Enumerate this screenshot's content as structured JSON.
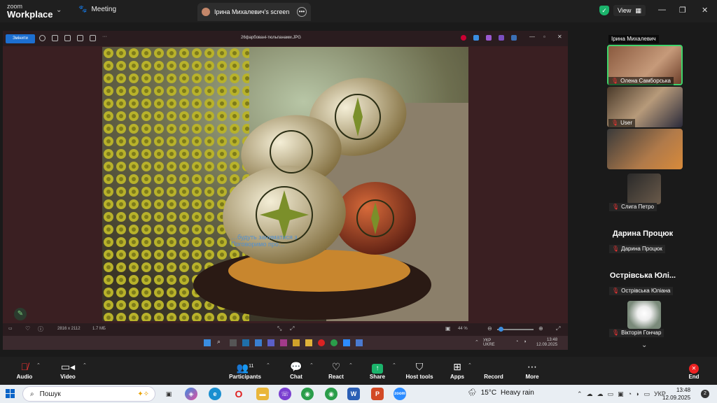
{
  "zoom": {
    "brand_line1": "zoom",
    "brand_line2": "Workplace",
    "meeting_tab": "Meeting",
    "screen_tab": "Ірина Михалевич's screen",
    "view_label": "View"
  },
  "viewer": {
    "edit_label": "Змінити",
    "file_title": "26фарбовані-тюльпанами.JPG",
    "dimensions": "2816 x 2112",
    "size": "1.7 МБ",
    "zoom_pct": "44 %",
    "inner_time": "13:48",
    "inner_date": "12.09.2025",
    "inner_lang1": "УКР",
    "inner_lang2": "UKRE",
    "overlay_line1": "…будуть заниматися з",
    "overlay_line2": "Поговоримо про…"
  },
  "gallery": {
    "tiles": [
      {
        "name": "Ірина Михалевич",
        "muted": false
      },
      {
        "name": "Олена Самборська",
        "muted": true
      },
      {
        "name": "User",
        "muted": true
      },
      {
        "name": "Слига Петро",
        "muted": true
      }
    ],
    "text_tiles": [
      {
        "big": "Дарина Процюк",
        "small": "Дарина Процюк"
      },
      {
        "big": "Острівська Юлі...",
        "small": "Острівська Юліана"
      }
    ],
    "last_tile": {
      "name": "Вікторія Гончар"
    }
  },
  "controls": {
    "audio": "Audio",
    "video": "Video",
    "participants": "Participants",
    "participants_count": "11",
    "chat": "Chat",
    "react": "React",
    "share": "Share",
    "host_tools": "Host tools",
    "apps": "Apps",
    "more": "More",
    "record": "Record",
    "end": "End"
  },
  "taskbar": {
    "search_placeholder": "Пошук",
    "weather_temp": "15°C",
    "weather_desc": "Heavy rain",
    "lang": "УКР",
    "time": "13:48",
    "date": "12.09.2025",
    "notif_count": "2"
  }
}
